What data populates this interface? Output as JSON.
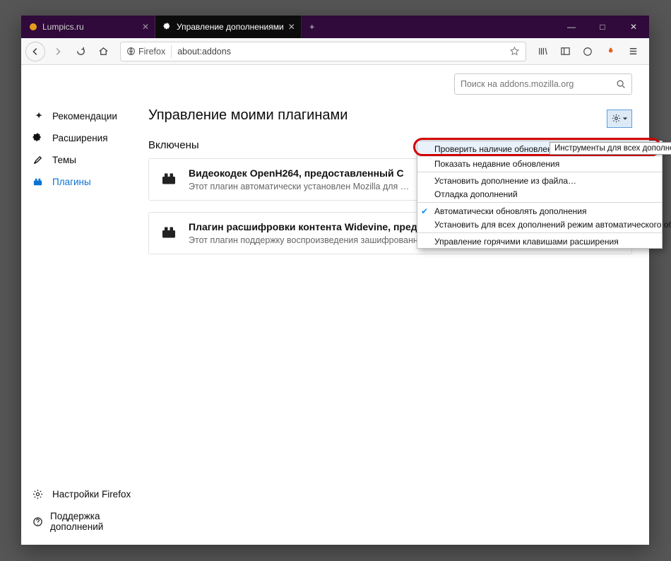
{
  "window": {
    "min": "—",
    "max": "□",
    "close": "✕"
  },
  "tabs": [
    {
      "title": "Lumpics.ru",
      "active": false
    },
    {
      "title": "Управление дополнениями",
      "active": true
    }
  ],
  "address": {
    "identity": "Firefox",
    "url": "about:addons"
  },
  "search": {
    "placeholder": "Поиск на addons.mozilla.org"
  },
  "page_title": "Управление моими плагинами",
  "section_title": "Включены",
  "sidebar": {
    "items": [
      {
        "label": "Рекомендации"
      },
      {
        "label": "Расширения"
      },
      {
        "label": "Темы"
      },
      {
        "label": "Плагины"
      }
    ],
    "footer": [
      {
        "label": "Настройки Firefox"
      },
      {
        "label": "Поддержка дополнений"
      }
    ]
  },
  "plugins": [
    {
      "title": "Видеокодек OpenH264, предоставленный C",
      "desc": "Этот плагин автоматически установлен Mozilla для …"
    },
    {
      "title": "Плагин расшифровки контента Widevine, предоставленный Google Inc.",
      "desc": "Этот плагин поддержку воспроизведения зашифрованного медиа в соответс…"
    }
  ],
  "menu": {
    "items": [
      "Проверить наличие обновлений",
      "Показать недавние обновления",
      "Установить дополнение из файла…",
      "Отладка дополнений",
      "Автоматически обновлять дополнения",
      "Установить для всех дополнений режим автоматического обновления",
      "Управление горячими клавишами расширения"
    ]
  },
  "tooltip": "Инструменты для всех дополнений"
}
